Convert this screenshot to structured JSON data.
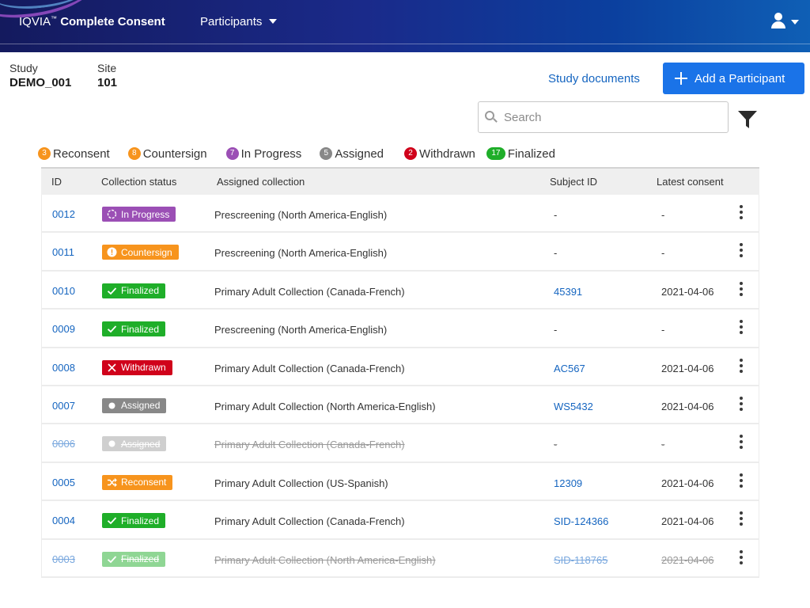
{
  "header": {
    "brand_name": "IQVIA",
    "brand_tm": "™",
    "brand_product": "Complete Consent",
    "nav_participants": "Participants"
  },
  "study": {
    "study_label": "Study",
    "study_value": "DEMO_001",
    "site_label": "Site",
    "site_value": "101",
    "documents_link": "Study documents",
    "add_button": "Add a Participant"
  },
  "search": {
    "placeholder": "Search",
    "value": ""
  },
  "summary": [
    {
      "count": "3",
      "label": "Reconsent",
      "color": "#f7941d"
    },
    {
      "count": "8",
      "label": "Countersign",
      "color": "#f7941d"
    },
    {
      "count": "7",
      "label": "In Progress",
      "color": "#9b4fb5"
    },
    {
      "count": "5",
      "label": "Assigned",
      "color": "#888888"
    },
    {
      "count": "2",
      "label": "Withdrawn",
      "color": "#d0021b"
    },
    {
      "count": "17",
      "label": "Finalized",
      "color": "#1fae29"
    }
  ],
  "table": {
    "columns": {
      "id": "ID",
      "status": "Collection status",
      "collection": "Assigned collection",
      "subject": "Subject ID",
      "consent": "Latest consent"
    },
    "rows": [
      {
        "id": "0012",
        "status": "In Progress",
        "status_icon": "in-progress-icon",
        "status_color": "#9b4fb5",
        "collection": "Prescreening (North America-English)",
        "subject": "-",
        "consent": "-",
        "struck": false
      },
      {
        "id": "0011",
        "status": "Countersign",
        "status_icon": "countersign-icon",
        "status_color": "#f7941d",
        "collection": "Prescreening (North America-English)",
        "subject": "-",
        "consent": "-",
        "struck": false
      },
      {
        "id": "0010",
        "status": "Finalized",
        "status_icon": "check-icon",
        "status_color": "#1fae29",
        "collection": "Primary Adult Collection (Canada-French)",
        "subject": "45391",
        "consent": "2021-04-06",
        "struck": false
      },
      {
        "id": "0009",
        "status": "Finalized",
        "status_icon": "check-icon",
        "status_color": "#1fae29",
        "collection": "Prescreening (North America-English)",
        "subject": "-",
        "consent": "-",
        "struck": false
      },
      {
        "id": "0008",
        "status": "Withdrawn",
        "status_icon": "x-icon",
        "status_color": "#d0021b",
        "collection": "Primary Adult Collection (Canada-French)",
        "subject": "AC567",
        "consent": "2021-04-06",
        "struck": false
      },
      {
        "id": "0007",
        "status": "Assigned",
        "status_icon": "dot-icon",
        "status_color": "#888888",
        "collection": "Primary Adult Collection (North America-English)",
        "subject": "WS5432",
        "consent": "2021-04-06",
        "struck": false
      },
      {
        "id": "0006",
        "status": "Assigned",
        "status_icon": "dot-icon",
        "status_color": "#cfcfcf",
        "collection": "Primary Adult Collection (Canada-French)",
        "subject": "-",
        "consent": "-",
        "struck": true
      },
      {
        "id": "0005",
        "status": "Reconsent",
        "status_icon": "shuffle-icon",
        "status_color": "#f7941d",
        "collection": "Primary Adult Collection (US-Spanish)",
        "subject": "12309",
        "consent": "2021-04-06",
        "struck": false
      },
      {
        "id": "0004",
        "status": "Finalized",
        "status_icon": "check-icon",
        "status_color": "#1fae29",
        "collection": "Primary Adult Collection (Canada-French)",
        "subject": "SID-124366",
        "consent": "2021-04-06",
        "struck": false
      },
      {
        "id": "0003",
        "status": "Finalized",
        "status_icon": "check-icon",
        "status_color": "#8fd694",
        "collection": "Primary Adult Collection (North America-English)",
        "subject": "SID-118765",
        "consent": "2021-04-06",
        "struck": true
      }
    ]
  }
}
